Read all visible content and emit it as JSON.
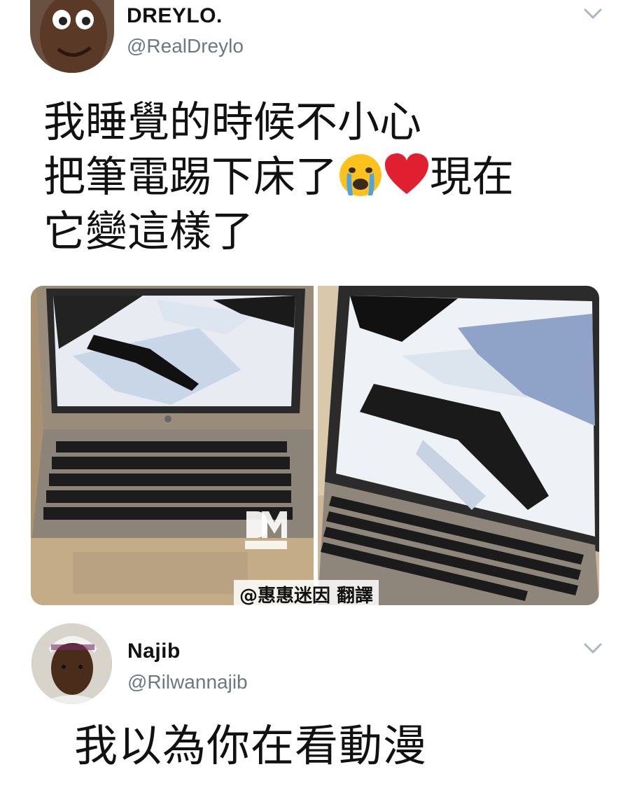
{
  "tweet1": {
    "name": "DREYLO.",
    "handle": "@RealDreylo",
    "text_line1": "我睡覺的時候不小心",
    "text_line2a": "把筆電踢下床了",
    "text_line2b": "現在",
    "text_line3": "它變這樣了",
    "emojis": [
      "crying-face-emoji",
      "red-heart-emoji"
    ]
  },
  "media": {
    "caption": "@惠惠迷因 翻譯",
    "watermark": "DANK MEMEOLOGY"
  },
  "tweet2": {
    "name": "Najib",
    "handle": "@Rilwannajib",
    "text": "我以為你在看動漫"
  },
  "colors": {
    "handle_gray": "#6b7880",
    "chevron_gray": "#aab8c2"
  }
}
